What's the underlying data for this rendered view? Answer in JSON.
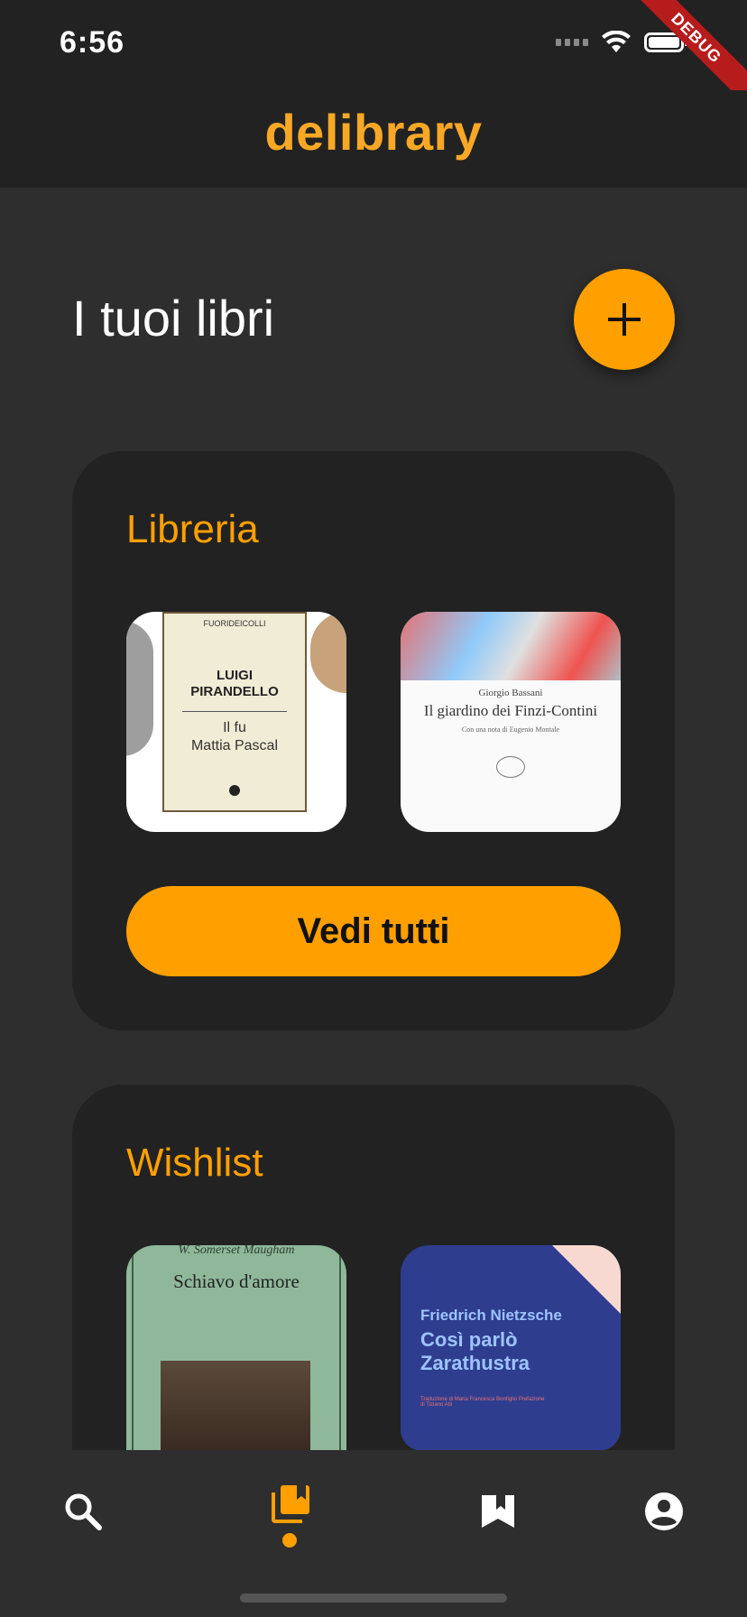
{
  "status_bar": {
    "time": "6:56",
    "debug_label": "DEBUG"
  },
  "app": {
    "title": "delibrary",
    "accent_color": "#ffa000"
  },
  "page": {
    "title": "I tuoi libri",
    "add_button_icon": "plus-icon"
  },
  "library_card": {
    "title": "Libreria",
    "books": [
      {
        "author": "LUIGI PIRANDELLO",
        "title_line1": "Il fu",
        "title_line2": "Mattia Pascal",
        "publisher": "FUORIDEICOLLI"
      },
      {
        "author": "Giorgio Bassani",
        "title": "Il giardino dei Finzi-Contini",
        "subtitle": "Con una nota di Eugenio Montale"
      }
    ],
    "see_all_label": "Vedi tutti"
  },
  "wishlist_card": {
    "title": "Wishlist",
    "books": [
      {
        "author": "W. Somerset Maugham",
        "title": "Schiavo d'amore"
      },
      {
        "author": "Friedrich Nietzsche",
        "title_line1": "Così parlò",
        "title_line2": "Zarathustra",
        "small_text": "Traduzione di Maria Francesca Bonfiglio Prefazione di Tiziano Atti"
      }
    ]
  },
  "bottom_nav": {
    "items": [
      {
        "icon": "search-icon",
        "active": false
      },
      {
        "icon": "library-books-icon",
        "active": true
      },
      {
        "icon": "bookmark-icon",
        "active": false
      },
      {
        "icon": "account-circle-icon",
        "active": false
      }
    ]
  }
}
